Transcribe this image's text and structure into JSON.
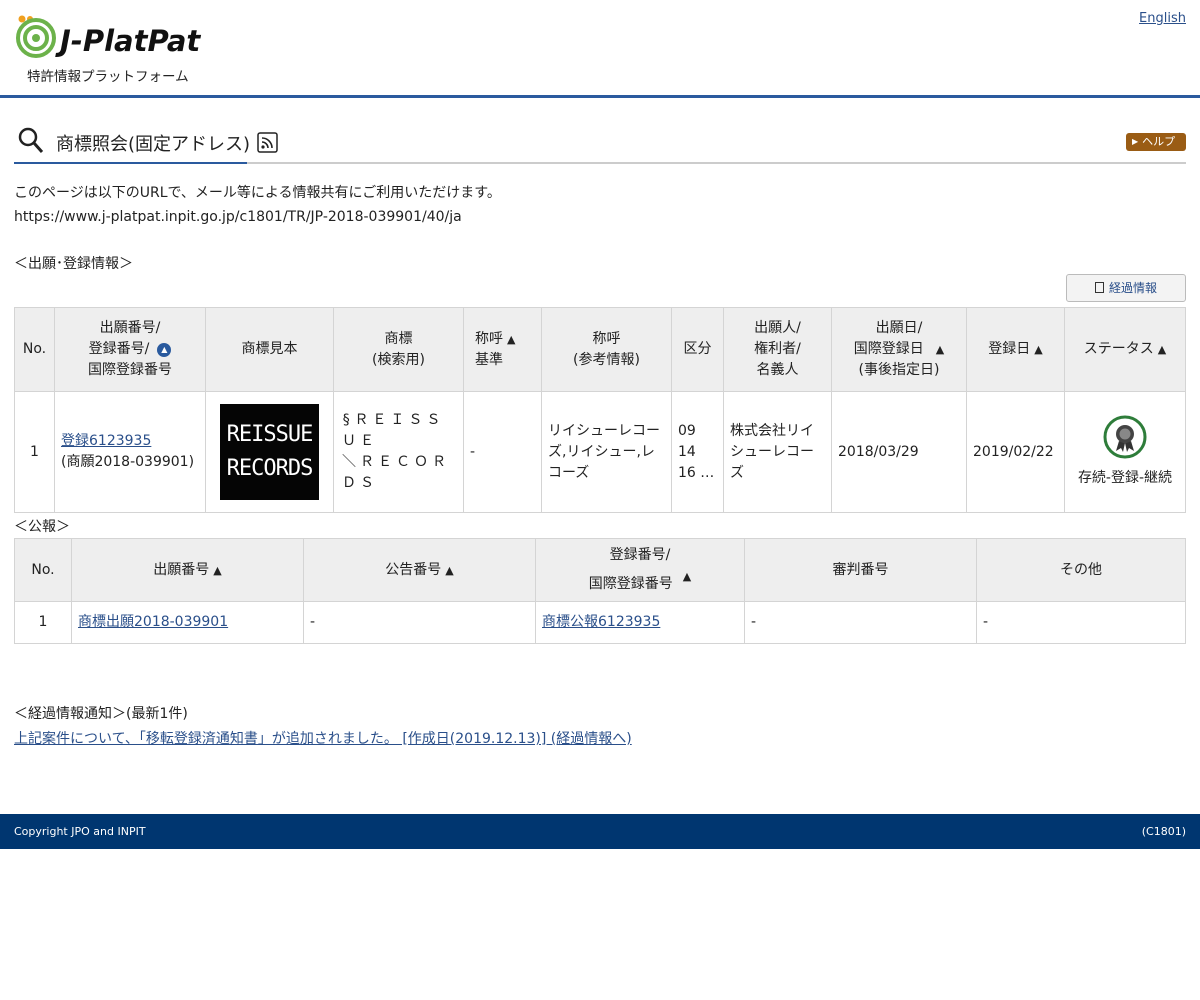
{
  "header": {
    "logo_text": "J-PlatPat",
    "logo_sub": "特許情報プラットフォーム",
    "lang_link": "English"
  },
  "title": {
    "text": "商標照会(固定アドレス)",
    "help_label": "ヘルプ"
  },
  "intro": {
    "line1": "このページは以下のURLで、メール等による情報共有にご利用いただけます。",
    "url": "https://www.j-platpat.inpit.go.jp/c1801/TR/JP-2018-039901/40/ja"
  },
  "registration": {
    "section_label": "＜出願･登録情報＞",
    "history_button": "経過情報",
    "headers": {
      "no": "No.",
      "app_num_l1": "出願番号/",
      "app_num_l2": "登録番号/",
      "app_num_l3": "国際登録番号",
      "tm_sample": "商標見本",
      "tm_l1": "商標",
      "tm_l2": "(検索用)",
      "call_l1": "称呼",
      "call_l2": "基準",
      "callref_l1": "称呼",
      "callref_l2": "(参考情報)",
      "class": "区分",
      "owner_l1": "出願人/",
      "owner_l2": "権利者/",
      "owner_l3": "名義人",
      "date_l1": "出願日/",
      "date_l2": "国際登録日",
      "date_l3": "(事後指定日)",
      "reg_date": "登録日",
      "status": "ステータス"
    },
    "row": {
      "no": "1",
      "reg_link": "登録6123935",
      "app_num": "(商願2018-039901)",
      "tm_image_text_l1": "REISSUE",
      "tm_image_text_l2": "RECORDS",
      "tm_text_l1": "§ＲＥＩＳＳＵＥ",
      "tm_text_l2": "＼ＲＥＣＯＲＤＳ",
      "call_basis": "-",
      "call_ref_l1": "リイシューレコー",
      "call_ref_l2": "ズ,リイシュー,レ",
      "call_ref_l3": "コーズ",
      "class_l1": "09",
      "class_l2": "14",
      "class_l3": "16 …",
      "owner_l1": "株式会社リイ",
      "owner_l2": "シューレコー",
      "owner_l3": "ズ",
      "app_date": "2018/03/29",
      "reg_date": "2019/02/22",
      "status": "存続-登録-継続"
    }
  },
  "gazette": {
    "section_label": "＜公報＞",
    "headers": {
      "no": "No.",
      "app_num": "出願番号",
      "pub_num": "公告番号",
      "reg_l1": "登録番号/",
      "reg_l2": "国際登録番号",
      "trial": "審判番号",
      "other": "その他"
    },
    "row": {
      "no": "1",
      "app_link": "商標出願2018-039901",
      "pub": "-",
      "reg_link": "商標公報6123935",
      "trial": "-",
      "other": "-"
    }
  },
  "notice": {
    "label": "＜経過情報通知＞(最新1件)",
    "link": "上記案件について、「移転登録済通知書」が追加されました。 [作成日(2019.12.13)] (経過情報へ)"
  },
  "footer": {
    "copyright": "Copyright JPO and INPIT",
    "code": "(C1801)"
  },
  "colors": {
    "primary": "#2a5a9e",
    "footer": "#003670",
    "help": "#9a5c14",
    "status_green": "#2e7d3a"
  }
}
